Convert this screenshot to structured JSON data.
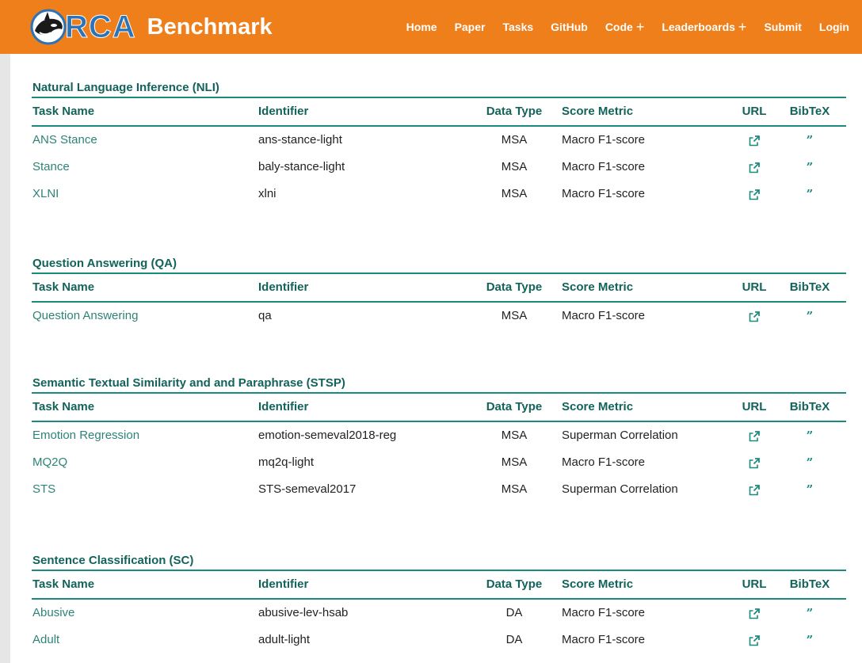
{
  "brand": {
    "logo_text": "RCA",
    "name": "Benchmark"
  },
  "nav": {
    "home": "Home",
    "paper": "Paper",
    "tasks": "Tasks",
    "github": "GitHub",
    "code": "Code",
    "leaderboards": "Leaderboards",
    "submit": "Submit",
    "login": "Login",
    "plus": "+"
  },
  "table_headers": {
    "task_name": "Task Name",
    "identifier": "Identifier",
    "data_type": "Data Type",
    "score_metric": "Score Metric",
    "url": "URL",
    "bibtex": "BibTeX"
  },
  "icons": {
    "url": "external-link-icon",
    "bibtex": "quote-icon",
    "quote_glyph": "”"
  },
  "colors": {
    "navbar": "#ef7f1a",
    "accent": "#1b8a7f",
    "link": "#2e8378"
  },
  "sections": [
    {
      "title": "Natural Language Inference (NLI)",
      "rows": [
        {
          "name": "ANS Stance",
          "identifier": "ans-stance-light",
          "type": "MSA",
          "metric": "Macro F1-score"
        },
        {
          "name": "Stance",
          "identifier": "baly-stance-light",
          "type": "MSA",
          "metric": "Macro F1-score"
        },
        {
          "name": "XLNI",
          "identifier": "xlni",
          "type": "MSA",
          "metric": "Macro F1-score"
        }
      ]
    },
    {
      "title": "Question Answering (QA)",
      "rows": [
        {
          "name": "Question Answering",
          "identifier": "qa",
          "type": "MSA",
          "metric": "Macro F1-score"
        }
      ]
    },
    {
      "title": "Semantic Textual Similarity and and Paraphrase (STSP)",
      "rows": [
        {
          "name": "Emotion Regression",
          "identifier": "emotion-semeval2018-reg",
          "type": "MSA",
          "metric": "Superman Correlation"
        },
        {
          "name": "MQ2Q",
          "identifier": "mq2q-light",
          "type": "MSA",
          "metric": "Macro F1-score"
        },
        {
          "name": "STS",
          "identifier": "STS-semeval2017",
          "type": "MSA",
          "metric": "Superman Correlation"
        }
      ]
    },
    {
      "title": "Sentence Classification (SC)",
      "rows": [
        {
          "name": "Abusive",
          "identifier": "abusive-lev-hsab",
          "type": "DA",
          "metric": "Macro F1-score"
        },
        {
          "name": "Adult",
          "identifier": "adult-light",
          "type": "DA",
          "metric": "Macro F1-score"
        }
      ]
    }
  ]
}
